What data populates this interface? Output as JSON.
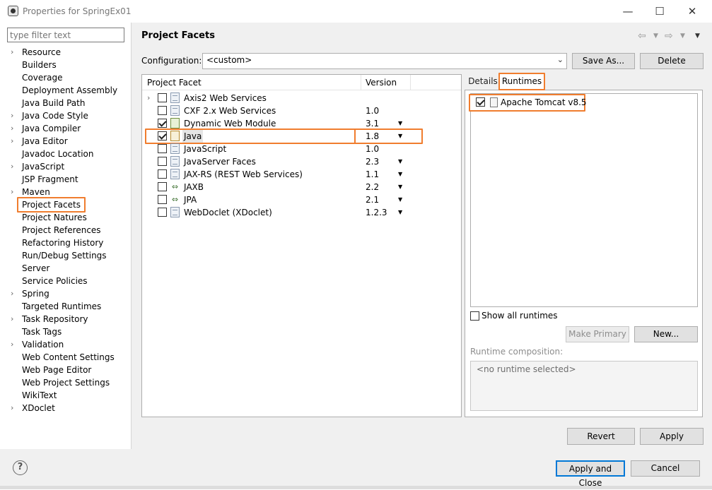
{
  "window": {
    "title": "Properties for SpringEx01",
    "minimize_glyph": "—",
    "maximize_glyph": "☐",
    "close_glyph": "✕"
  },
  "filter": {
    "placeholder": "type filter text"
  },
  "nav": {
    "items": [
      {
        "label": "Resource",
        "expandable": true
      },
      {
        "label": "Builders",
        "expandable": false
      },
      {
        "label": "Coverage",
        "expandable": false
      },
      {
        "label": "Deployment Assembly",
        "expandable": false
      },
      {
        "label": "Java Build Path",
        "expandable": false
      },
      {
        "label": "Java Code Style",
        "expandable": true
      },
      {
        "label": "Java Compiler",
        "expandable": true
      },
      {
        "label": "Java Editor",
        "expandable": true
      },
      {
        "label": "Javadoc Location",
        "expandable": false
      },
      {
        "label": "JavaScript",
        "expandable": true
      },
      {
        "label": "JSP Fragment",
        "expandable": false
      },
      {
        "label": "Maven",
        "expandable": true
      },
      {
        "label": "Project Facets",
        "expandable": false,
        "selected": true
      },
      {
        "label": "Project Natures",
        "expandable": false
      },
      {
        "label": "Project References",
        "expandable": false
      },
      {
        "label": "Refactoring History",
        "expandable": false
      },
      {
        "label": "Run/Debug Settings",
        "expandable": false
      },
      {
        "label": "Server",
        "expandable": false
      },
      {
        "label": "Service Policies",
        "expandable": false
      },
      {
        "label": "Spring",
        "expandable": true
      },
      {
        "label": "Targeted Runtimes",
        "expandable": false
      },
      {
        "label": "Task Repository",
        "expandable": true
      },
      {
        "label": "Task Tags",
        "expandable": false
      },
      {
        "label": "Validation",
        "expandable": true
      },
      {
        "label": "Web Content Settings",
        "expandable": false
      },
      {
        "label": "Web Page Editor",
        "expandable": false
      },
      {
        "label": "Web Project Settings",
        "expandable": false
      },
      {
        "label": "WikiText",
        "expandable": false
      },
      {
        "label": "XDoclet",
        "expandable": true
      }
    ]
  },
  "page": {
    "title": "Project Facets",
    "config_label": "Configuration:",
    "config_value": "<custom>",
    "save_as": "Save As...",
    "delete": "Delete"
  },
  "facets": {
    "col_facet": "Project Facet",
    "col_version": "Version",
    "rows": [
      {
        "name": "Axis2 Web Services",
        "version": "",
        "checked": false,
        "expandable": true,
        "dropdown": false,
        "icon": "document-icon"
      },
      {
        "name": "CXF 2.x Web Services",
        "version": "1.0",
        "checked": false,
        "expandable": false,
        "dropdown": false,
        "icon": "document-icon"
      },
      {
        "name": "Dynamic Web Module",
        "version": "3.1",
        "checked": true,
        "expandable": false,
        "dropdown": true,
        "icon": "web-module-icon"
      },
      {
        "name": "Java",
        "version": "1.8",
        "checked": true,
        "expandable": false,
        "dropdown": true,
        "icon": "java-icon",
        "selected": true
      },
      {
        "name": "JavaScript",
        "version": "1.0",
        "checked": false,
        "expandable": false,
        "dropdown": false,
        "icon": "document-icon"
      },
      {
        "name": "JavaServer Faces",
        "version": "2.3",
        "checked": false,
        "expandable": false,
        "dropdown": true,
        "icon": "document-icon"
      },
      {
        "name": "JAX-RS (REST Web Services)",
        "version": "1.1",
        "checked": false,
        "expandable": false,
        "dropdown": true,
        "icon": "document-icon"
      },
      {
        "name": "JAXB",
        "version": "2.2",
        "checked": false,
        "expandable": false,
        "dropdown": true,
        "icon": "arrows-icon"
      },
      {
        "name": "JPA",
        "version": "2.1",
        "checked": false,
        "expandable": false,
        "dropdown": true,
        "icon": "arrows-icon"
      },
      {
        "name": "WebDoclet (XDoclet)",
        "version": "1.2.3",
        "checked": false,
        "expandable": false,
        "dropdown": true,
        "icon": "document-icon"
      }
    ]
  },
  "runtimes": {
    "tab_details": "Details",
    "tab_runtimes": "Runtimes",
    "items": [
      {
        "name": "Apache Tomcat v8.5",
        "checked": true
      }
    ],
    "show_all": "Show all runtimes",
    "make_primary": "Make Primary",
    "new": "New...",
    "composition_label": "Runtime composition:",
    "composition_value": "<no runtime selected>"
  },
  "buttons": {
    "revert": "Revert",
    "apply": "Apply",
    "apply_close": "Apply and Close",
    "cancel": "Cancel",
    "help": "?"
  },
  "colors": {
    "highlight": "#f07d2e",
    "primary_button_border": "#0078d7"
  }
}
